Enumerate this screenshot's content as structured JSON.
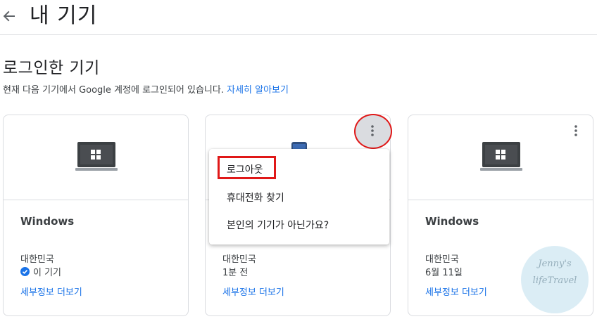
{
  "header": {
    "back_icon": "arrow-left-icon",
    "title": "내 기기"
  },
  "section": {
    "title": "로그인한 기기",
    "description": "현재 다음 기기에서 Google 계정에 로그인되어 있습니다.",
    "learn_more": "자세히 알아보기"
  },
  "cards": [
    {
      "name": "Windows",
      "location": "대한민국",
      "when": "이 기기",
      "details": "세부정보 더보기",
      "icon": "laptop-icon"
    },
    {
      "name": "",
      "location": "대한민국",
      "when": "1분 전",
      "details": "세부정보 더보기",
      "icon": "phone-icon"
    },
    {
      "name": "Windows",
      "location": "대한민국",
      "when": "6월 11일",
      "details": "세부정보 더보기",
      "icon": "laptop-icon"
    }
  ],
  "menu": {
    "items": [
      "로그아웃",
      "휴대전화 찾기",
      "본인의 기기가 아닌가요?"
    ]
  },
  "watermark": {
    "line1": "Jenny's",
    "line2": "lifeTravel"
  },
  "colors": {
    "link": "#1a73e8",
    "highlight": "#e01818",
    "border": "#dadce0",
    "check": "#1a73e8"
  }
}
